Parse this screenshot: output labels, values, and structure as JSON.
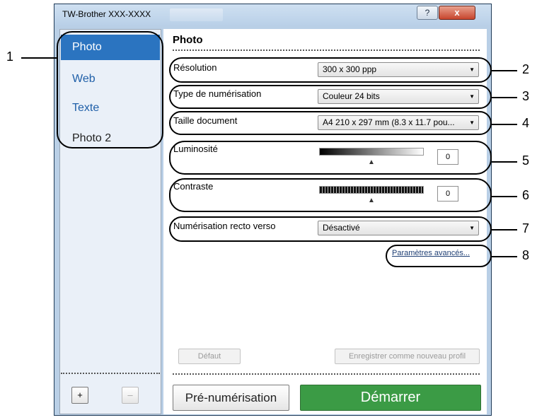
{
  "window": {
    "title": "TW-Brother XXX-XXXX",
    "help_label": "?",
    "close_label": "x"
  },
  "sidebar": {
    "items": [
      {
        "label": "Photo",
        "state": "selected"
      },
      {
        "label": "Web",
        "state": "link"
      },
      {
        "label": "Texte",
        "state": "link"
      },
      {
        "label": "Photo 2",
        "state": "normal"
      }
    ],
    "add_label": "+",
    "remove_label": "–"
  },
  "main": {
    "title": "Photo",
    "resolution": {
      "label": "Résolution",
      "value": "300 x 300 ppp"
    },
    "scan_type": {
      "label": "Type de numérisation",
      "value": "Couleur 24 bits"
    },
    "document_size": {
      "label": "Taille document",
      "value": "A4 210 x 297 mm (8.3 x 11.7 pou..."
    },
    "brightness": {
      "label": "Luminosité",
      "value": "0",
      "slider_fraction": 0.5
    },
    "contrast": {
      "label": "Contraste",
      "value": "0",
      "slider_fraction": 0.5
    },
    "duplex": {
      "label": "Numérisation recto verso",
      "value": "Désactivé"
    },
    "advanced_link": "Paramètres avancés...",
    "default_button": "Défaut",
    "save_profile_button": "Enregistrer comme nouveau profil",
    "prescan_button": "Pré-numérisation",
    "start_button": "Démarrer"
  },
  "callouts": [
    "1",
    "2",
    "3",
    "4",
    "5",
    "6",
    "7",
    "8"
  ],
  "colors": {
    "accent_selected": "#2b74c0",
    "start_green": "#3b9b45",
    "close_red": "#c7452d"
  }
}
